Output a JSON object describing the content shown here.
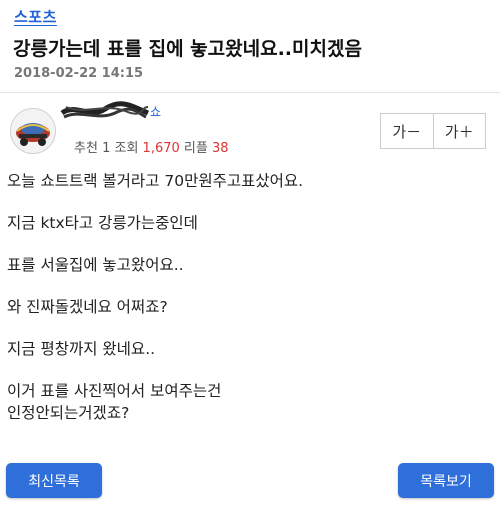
{
  "header": {
    "category": "스포츠",
    "title": "강릉가는데 표를 집에 놓고왔네요..미치겠음",
    "datetime": "2018-02-22 14:15"
  },
  "author": {
    "nickname_suffix": "쇼",
    "recommend_label": "추천",
    "recommend_count": "1",
    "views_label": "조회",
    "views_count": "1,670",
    "reply_label": "리플",
    "reply_count": "38"
  },
  "font_controls": {
    "decrease": "가－",
    "increase": "가＋"
  },
  "post": {
    "paragraphs": [
      "오늘 쇼트트랙 볼거라고 70만원주고표샀어요.",
      "지금 ktx타고 강릉가는중인데",
      "표를 서울집에 놓고왔어요..",
      "와 진짜돌겠네요 어쩌죠?",
      "지금 평창까지 왔네요..",
      "이거 표를 사진찍어서 보여주는건",
      "인정안되는거겠죠?"
    ]
  },
  "footer": {
    "latest_list": "최신목록",
    "view_list": "목록보기"
  },
  "colors": {
    "accent_blue": "#1f63d6",
    "button_blue": "#2f6fd9",
    "count_red": "#d33333"
  }
}
